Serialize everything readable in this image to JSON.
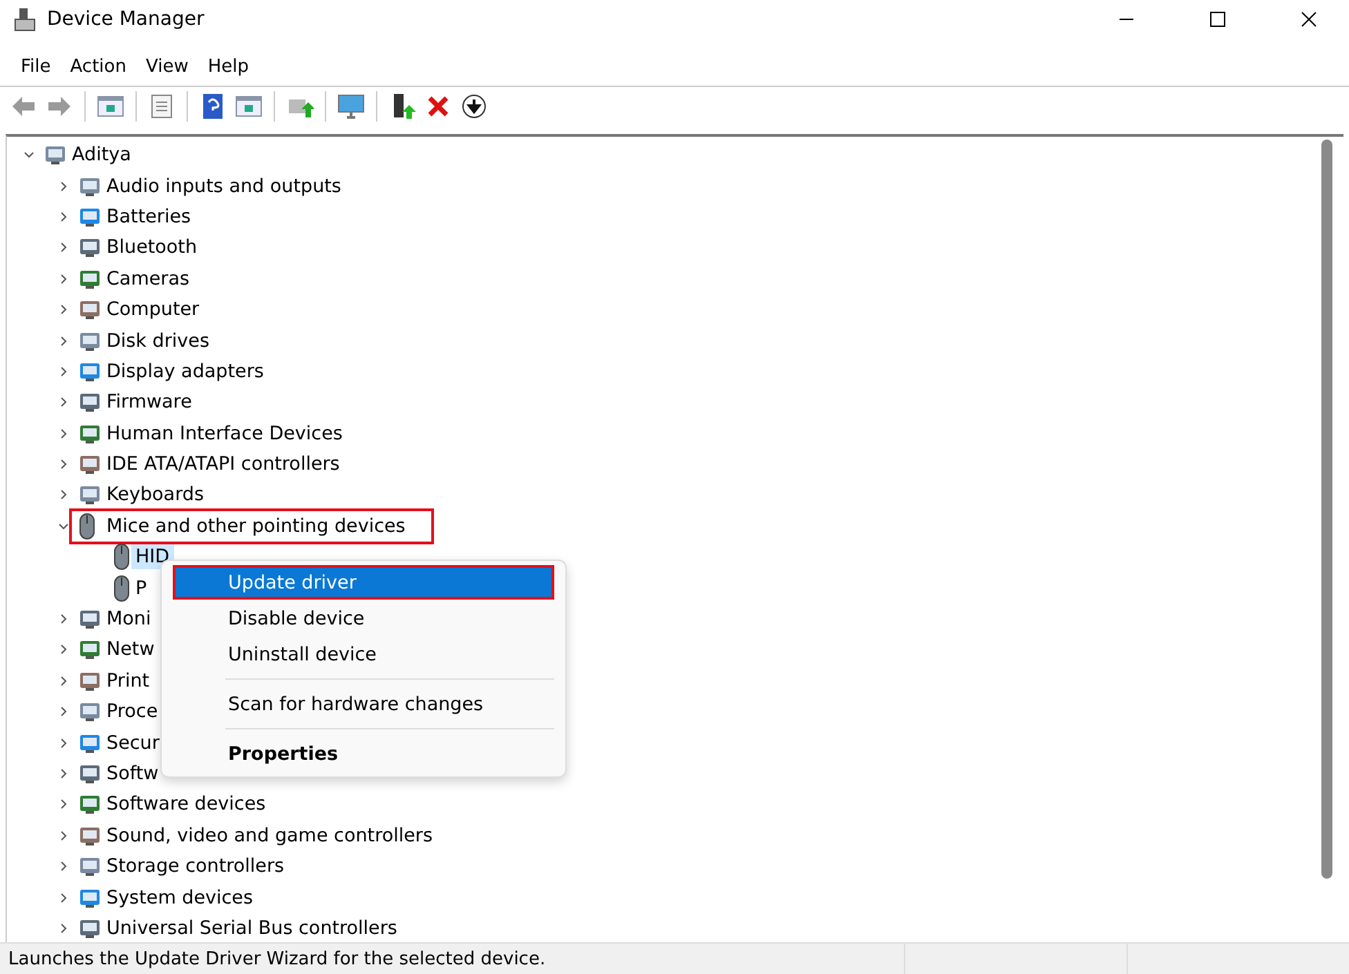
{
  "window": {
    "title": "Device Manager"
  },
  "menu_bar": [
    "File",
    "Action",
    "View",
    "Help"
  ],
  "tree": {
    "label": "Aditya",
    "expanded": true,
    "children": [
      {
        "label": "Audio inputs and outputs",
        "expanded": false
      },
      {
        "label": "Batteries",
        "expanded": false
      },
      {
        "label": "Bluetooth",
        "expanded": false
      },
      {
        "label": "Cameras",
        "expanded": false
      },
      {
        "label": "Computer",
        "expanded": false
      },
      {
        "label": "Disk drives",
        "expanded": false
      },
      {
        "label": "Display adapters",
        "expanded": false
      },
      {
        "label": "Firmware",
        "expanded": false
      },
      {
        "label": "Human Interface Devices",
        "expanded": false
      },
      {
        "label": "IDE ATA/ATAPI controllers",
        "expanded": false
      },
      {
        "label": "Keyboards",
        "expanded": false
      },
      {
        "label": "Mice and other pointing devices",
        "expanded": true,
        "annotated": true,
        "children": [
          {
            "label": "HID",
            "selected": true
          },
          {
            "label": "P",
            "selected": false
          }
        ]
      },
      {
        "label": "Moni",
        "expanded": false
      },
      {
        "label": "Netw",
        "expanded": false
      },
      {
        "label": "Print",
        "expanded": false
      },
      {
        "label": "Proce",
        "expanded": false
      },
      {
        "label": "Secur",
        "expanded": false
      },
      {
        "label": "Softw",
        "expanded": false
      },
      {
        "label": "Software devices",
        "expanded": false
      },
      {
        "label": "Sound, video and game controllers",
        "expanded": false
      },
      {
        "label": "Storage controllers",
        "expanded": false
      },
      {
        "label": "System devices",
        "expanded": false
      },
      {
        "label": "Universal Serial Bus controllers",
        "expanded": false
      }
    ]
  },
  "context_menu": [
    {
      "kind": "item",
      "label": "Update driver",
      "selected": true,
      "annotated": true
    },
    {
      "kind": "item",
      "label": "Disable device",
      "selected": false
    },
    {
      "kind": "item",
      "label": "Uninstall device",
      "selected": false
    },
    {
      "kind": "separator"
    },
    {
      "kind": "item",
      "label": "Scan for hardware changes",
      "selected": false
    },
    {
      "kind": "separator"
    },
    {
      "kind": "default",
      "label": "Properties",
      "selected": false
    }
  ],
  "status_bar": "Launches the Update Driver Wizard for the selected device."
}
